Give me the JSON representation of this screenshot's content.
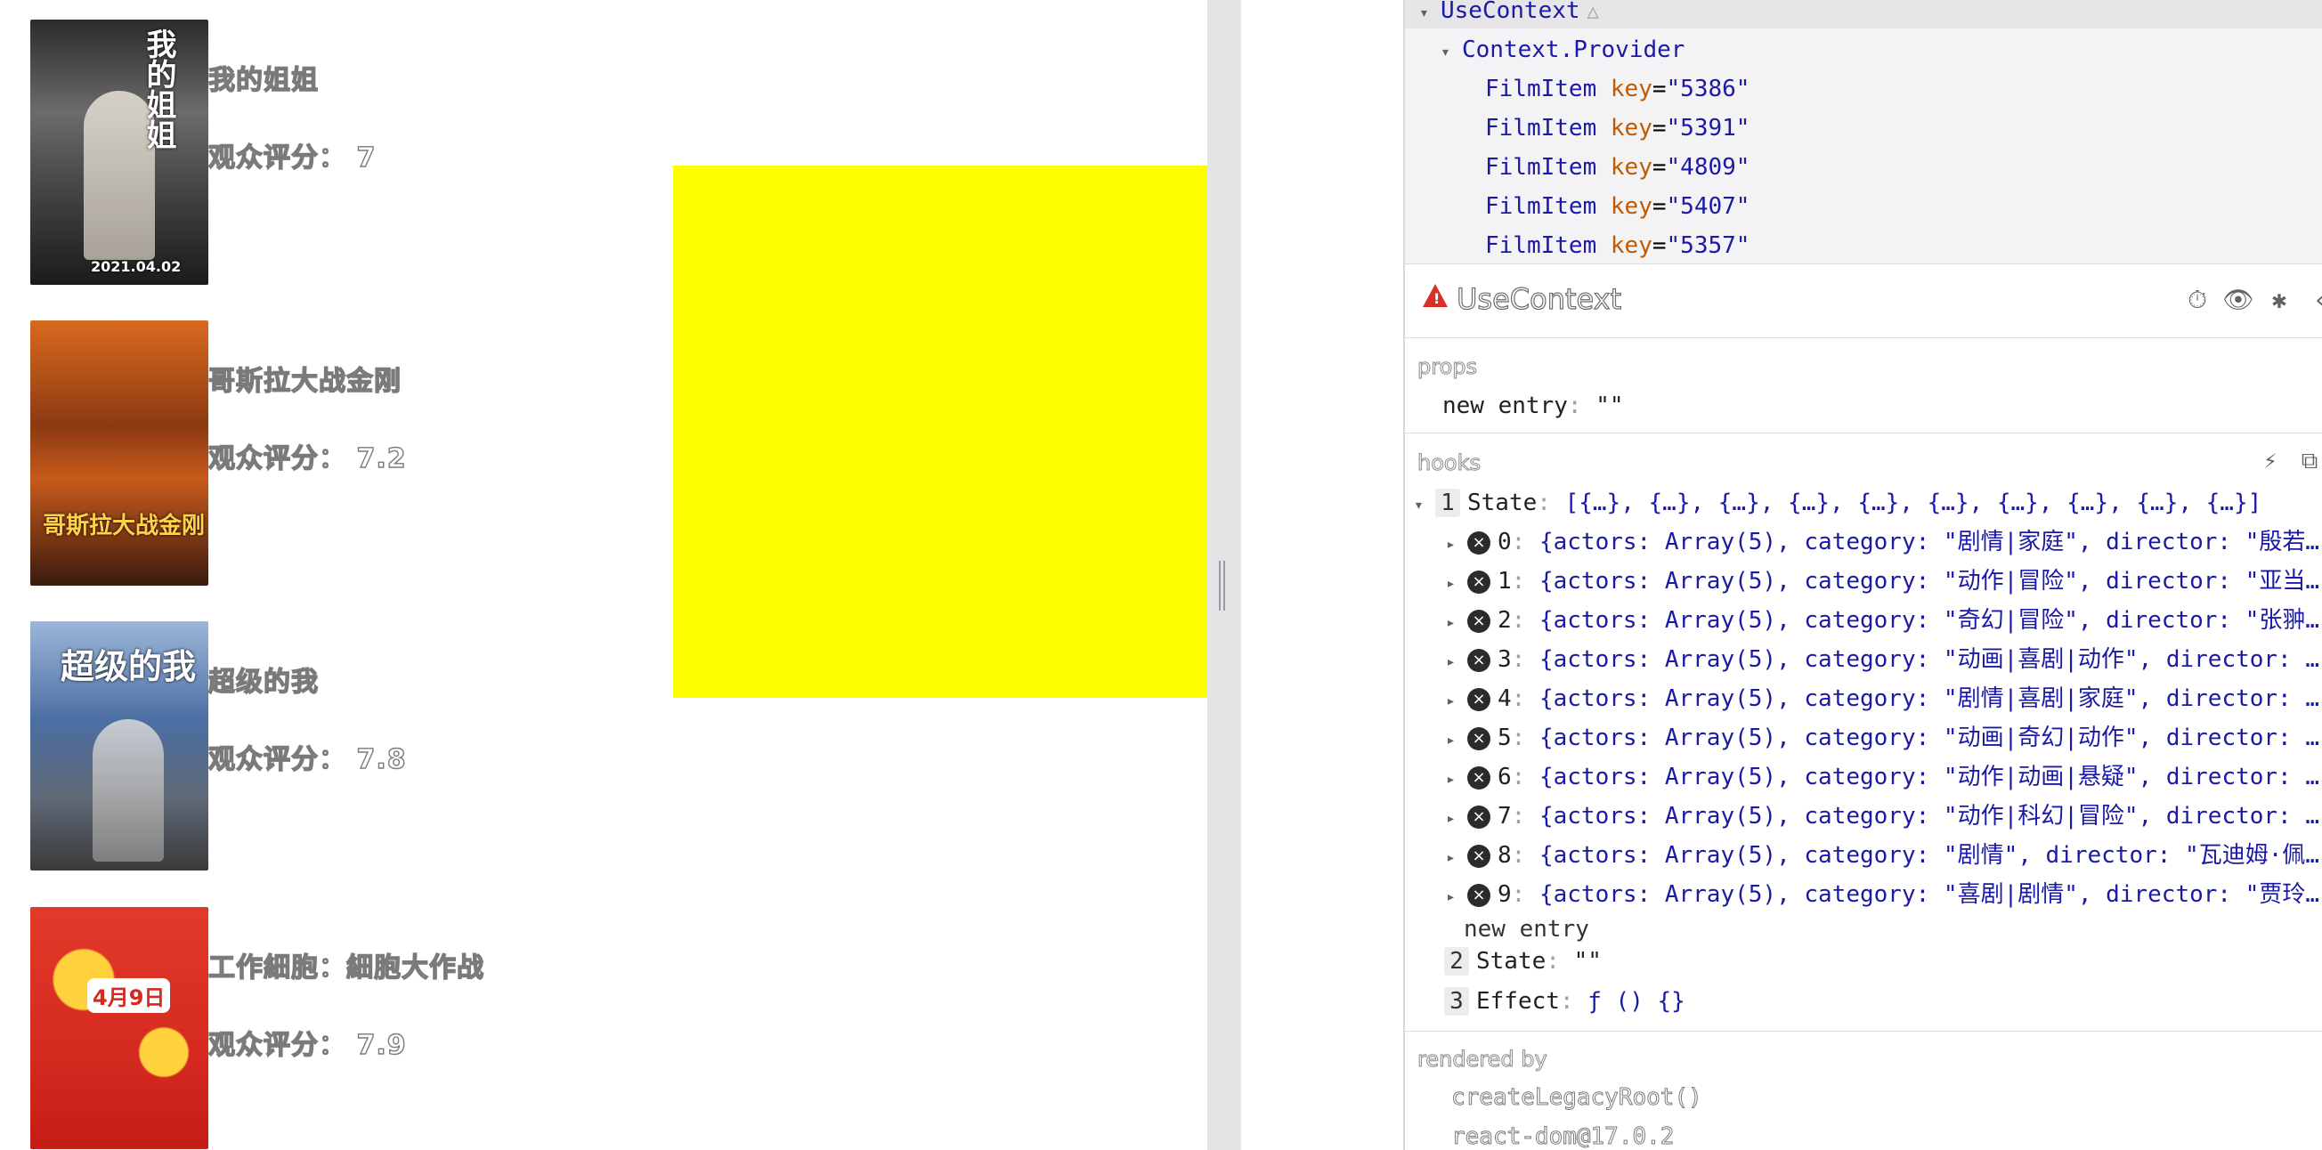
{
  "films": [
    {
      "title": "我的姐姐",
      "score": "观众评分： 7",
      "poster_text": "我的姐姐",
      "poster_date": "2021.04.02"
    },
    {
      "title": "哥斯拉大战金刚",
      "score": "观众评分： 7.2",
      "poster_text": "哥斯拉大战金刚"
    },
    {
      "title": "超级的我",
      "score": "观众评分： 7.8",
      "poster_text": "超级的我"
    },
    {
      "title": "工作細胞：細胞大作战",
      "score": "观众评分： 7.9",
      "poster_text": "4月9日"
    }
  ],
  "devtools": {
    "tree": {
      "root": "UseContext",
      "provider": "Context.Provider",
      "items": [
        {
          "name": "FilmItem",
          "attr": "key",
          "value": "\"5386\""
        },
        {
          "name": "FilmItem",
          "attr": "key",
          "value": "\"5391\""
        },
        {
          "name": "FilmItem",
          "attr": "key",
          "value": "\"4809\""
        },
        {
          "name": "FilmItem",
          "attr": "key",
          "value": "\"5407\""
        },
        {
          "name": "FilmItem",
          "attr": "key",
          "value": "\"5357\""
        }
      ]
    },
    "selected": {
      "name": "UseContext",
      "icons": [
        "stopwatch-icon",
        "eye-icon",
        "bug-icon",
        "code-icon"
      ]
    },
    "props": {
      "label": "props",
      "new_entry_key": "new entry",
      "new_entry_value": "\"\""
    },
    "hooks": {
      "label": "hooks",
      "state1": {
        "num": "1",
        "label": "State",
        "value": "[{…}, {…}, {…}, {…}, {…}, {…}, {…}, {…}, {…}, {…}]",
        "entries": [
          {
            "index": "0",
            "value": "{actors: Array(5), category: \"剧情|家庭\", director: \"殷若…"
          },
          {
            "index": "1",
            "value": "{actors: Array(5), category: \"动作|冒险\", director: \"亚当…"
          },
          {
            "index": "2",
            "value": "{actors: Array(5), category: \"奇幻|冒险\", director: \"张翀…"
          },
          {
            "index": "3",
            "value": "{actors: Array(5), category: \"动画|喜剧|动作\", director: …"
          },
          {
            "index": "4",
            "value": "{actors: Array(5), category: \"剧情|喜剧|家庭\", director: …"
          },
          {
            "index": "5",
            "value": "{actors: Array(5), category: \"动画|奇幻|动作\", director: …"
          },
          {
            "index": "6",
            "value": "{actors: Array(5), category: \"动作|动画|悬疑\", director: …"
          },
          {
            "index": "7",
            "value": "{actors: Array(5), category: \"动作|科幻|冒险\", director: …"
          },
          {
            "index": "8",
            "value": "{actors: Array(5), category: \"剧情\", director: \"瓦迪姆·佩…"
          },
          {
            "index": "9",
            "value": "{actors: Array(5), category: \"喜剧|剧情\", director: \"贾玲…"
          }
        ],
        "new_entry": "new entry"
      },
      "state2": {
        "num": "2",
        "label": "State",
        "value": "\"\""
      },
      "effect3": {
        "num": "3",
        "label": "Effect",
        "value": "ƒ () {}"
      }
    },
    "rendered_by": {
      "label": "rendered by",
      "items": [
        "createLegacyRoot()",
        "react-dom@17.0.2"
      ]
    }
  }
}
